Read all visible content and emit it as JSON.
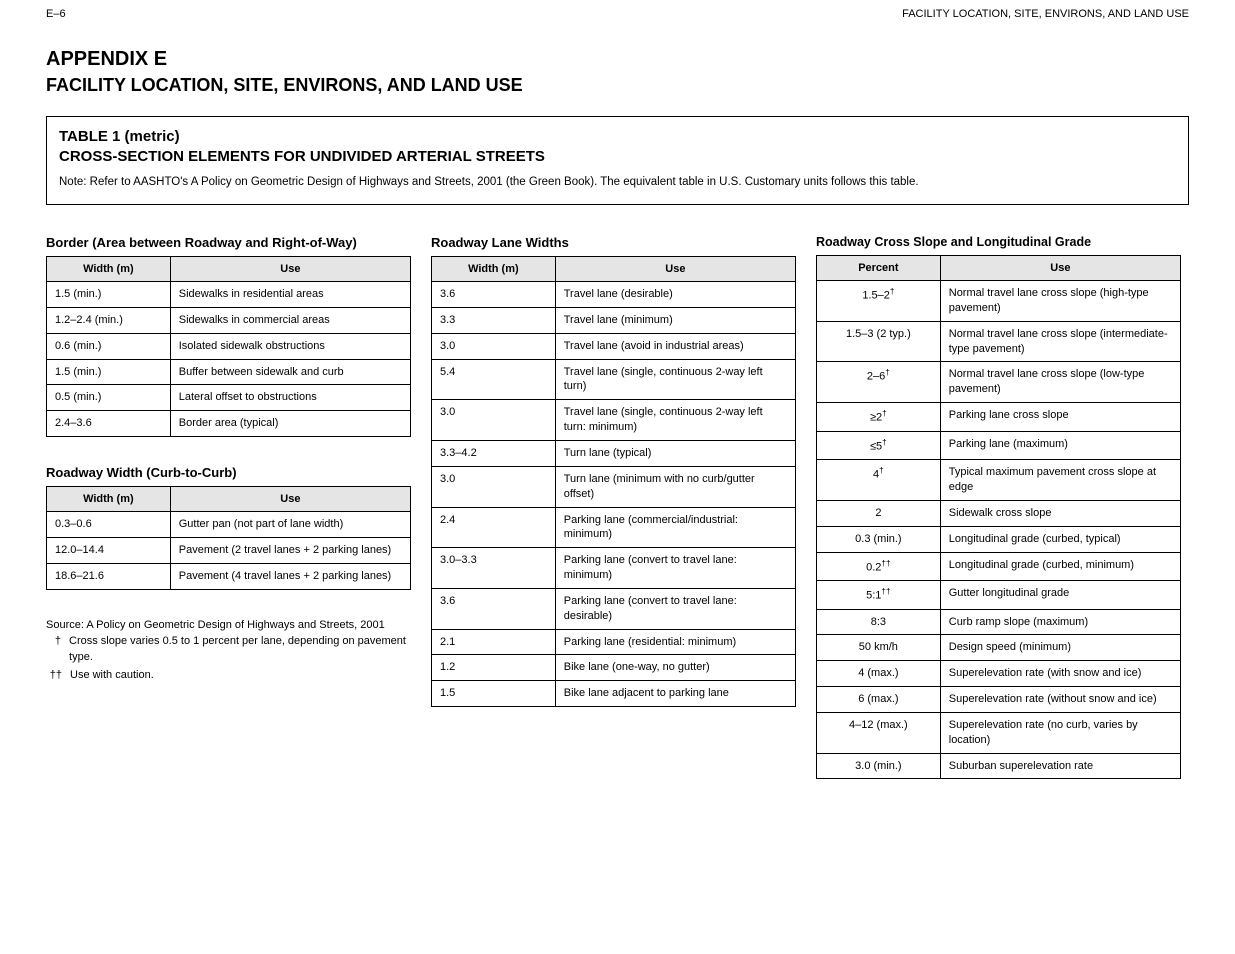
{
  "pagebar": {
    "left": "E–6",
    "right": "FACILITY LOCATION, SITE, ENVIRONS, AND LAND USE"
  },
  "heading1": "APPENDIX E",
  "heading2": "FACILITY LOCATION, SITE, ENVIRONS, AND LAND USE",
  "titlebox": {
    "line1": "TABLE 1 (metric)",
    "line2": "CROSS-SECTION ELEMENTS FOR UNDIVIDED ARTERIAL STREETS",
    "note": "Note: Refer to AASHTO's A Policy on Geometric Design of Highways and Streets, 2001 (the Green Book). The equivalent table in U.S. Customary units follows this table."
  },
  "col1": {
    "tableA": {
      "title": "Border (Area between Roadway and Right-of-Way)",
      "head": {
        "c1": "Width (m)",
        "c2": "Use"
      },
      "rows": [
        {
          "c1": "1.5 (min.)",
          "c2": "Sidewalks in residential areas"
        },
        {
          "c1": "1.2–2.4 (min.)",
          "c2": "Sidewalks in commercial areas"
        },
        {
          "c1": "0.6 (min.)",
          "c2": "Isolated sidewalk obstructions"
        },
        {
          "c1": "1.5 (min.)",
          "c2": "Buffer between sidewalk and curb"
        },
        {
          "c1": "0.5 (min.)",
          "c2": "Lateral offset to obstructions"
        },
        {
          "c1": "2.4–3.6",
          "c2": "Border area (typical)"
        }
      ]
    },
    "tableB": {
      "title": "Roadway Width (Curb-to-Curb)",
      "head": {
        "c1": "Width (m)",
        "c2": "Use"
      },
      "rows": [
        {
          "c1": "0.3–0.6",
          "c2": "Gutter pan (not part of lane width)"
        },
        {
          "c1": "12.0–14.4",
          "c2": "Pavement (2 travel lanes + 2 parking lanes)"
        },
        {
          "c1": "18.6–21.6",
          "c2": "Pavement (4 travel lanes + 2 parking lanes)"
        }
      ]
    }
  },
  "col2": {
    "tableA": {
      "title": "Roadway Lane Widths",
      "head": {
        "c1": "Width (m)",
        "c2": "Use"
      },
      "rows": [
        {
          "c1": "3.6",
          "c2": "Travel lane (desirable)"
        },
        {
          "c1": "3.3",
          "c2": "Travel lane (minimum)"
        },
        {
          "c1": "3.0",
          "c2": "Travel lane (avoid in industrial areas)"
        },
        {
          "c1": "5.4",
          "c2": "Travel lane (single, continuous 2-way left turn)"
        },
        {
          "c1": "3.0",
          "c2": "Travel lane (single, continuous 2-way left turn: minimum)"
        },
        {
          "c1": "3.3–4.2",
          "c2": "Turn lane (typical)"
        },
        {
          "c1": "3.0",
          "c2": "Turn lane (minimum with no curb/gutter offset)"
        },
        {
          "c1": "2.4",
          "c2": "Parking lane (commercial/industrial: minimum)"
        },
        {
          "c1": "3.0–3.3",
          "c2": "Parking lane (convert to travel lane: minimum)"
        },
        {
          "c1": "3.6",
          "c2": "Parking lane (convert to travel lane: desirable)"
        },
        {
          "c1": "2.1",
          "c2": "Parking lane (residential: minimum)"
        },
        {
          "c1": "1.2",
          "c2": "Bike lane (one-way, no gutter)"
        },
        {
          "c1": "1.5",
          "c2": "Bike lane adjacent to parking lane"
        }
      ]
    }
  },
  "col3": {
    "tableA": {
      "title": "Roadway Cross Slope and Longitudinal Grade",
      "head": {
        "c1": "Percent",
        "c2": "Use"
      },
      "rows": [
        {
          "c1": "1.5–2†",
          "c2": "Normal travel lane cross slope (high-type pavement)"
        },
        {
          "c1": "1.5–3 (2 typ.)",
          "c2": "Normal travel lane cross slope (intermediate-type pavement)"
        },
        {
          "c1": "2–6†",
          "c2": "Normal travel lane cross slope (low-type pavement)"
        },
        {
          "c1": "≥2†",
          "c2": "Parking lane cross slope"
        },
        {
          "c1": "≤5†",
          "c2": "Parking lane (maximum)"
        },
        {
          "c1": "4†",
          "c2": "Typical maximum pavement cross slope at edge"
        },
        {
          "c1": "2",
          "c2": "Sidewalk cross slope"
        },
        {
          "c1": "0.3 (min.)",
          "c2": "Longitudinal grade (curbed, typical)"
        },
        {
          "c1": "0.2††",
          "c2": "Longitudinal grade (curbed, minimum)"
        },
        {
          "c1": "5:1††",
          "c2": "Gutter longitudinal grade"
        },
        {
          "c1": "8:3",
          "c2": "Curb ramp slope (maximum)"
        },
        {
          "c1": "50 km/h",
          "c2": "Design speed (minimum)"
        },
        {
          "c1": "4 (max.)",
          "c2": "Superelevation rate (with snow and ice)"
        },
        {
          "c1": "6 (max.)",
          "c2": "Superelevation rate (without snow and ice)"
        },
        {
          "c1": "4–12 (max.)",
          "c2": "Superelevation rate (no curb, varies by location)"
        },
        {
          "c1": "3.0 (min.)",
          "c2": "Suburban superelevation rate"
        }
      ]
    }
  },
  "footnotes": {
    "source": "Source: A Policy on Geometric Design of Highways and Streets, 2001",
    "f1": {
      "mark": "†",
      "text": "Cross slope varies 0.5 to 1 percent per lane, depending on pavement type."
    },
    "f2": {
      "mark": "††",
      "text": "Use with caution."
    }
  }
}
